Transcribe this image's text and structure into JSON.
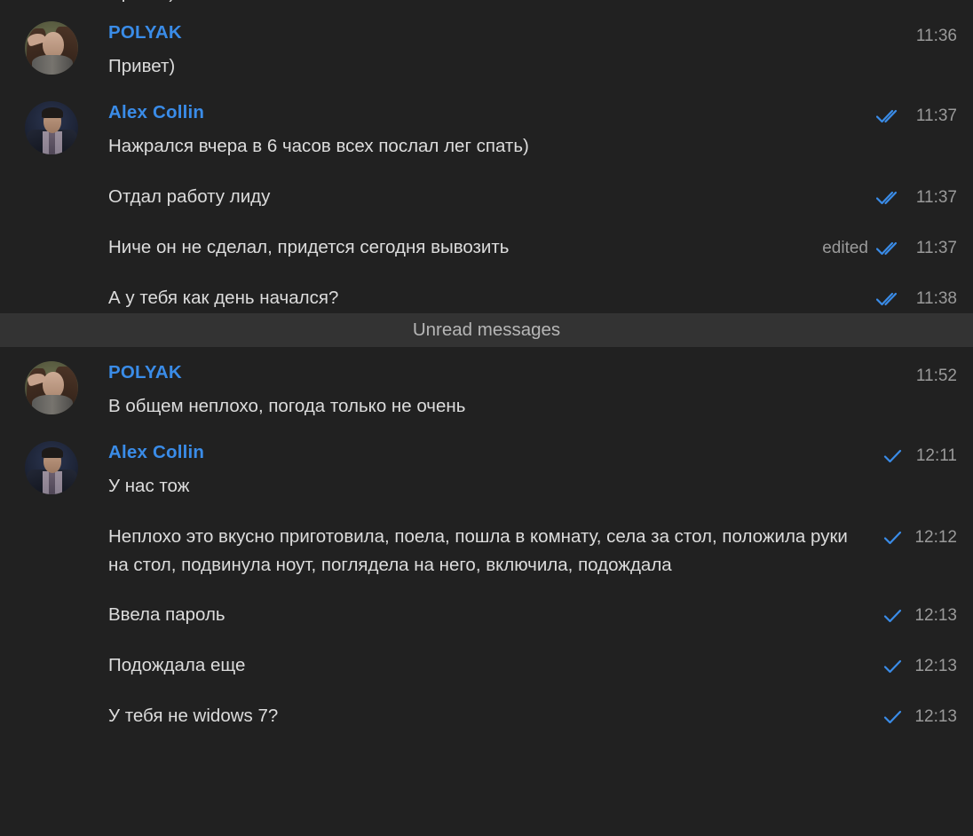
{
  "app": {
    "name": "telegram-chat",
    "background_color": "#212121",
    "accent_color": "#3a8ce8",
    "text_color": "#dcdcdc",
    "meta_color": "#9a9a9a",
    "divider_color": "#333333"
  },
  "cut_off_top": {
    "partial_text": "Привет)"
  },
  "divider": {
    "label": "Unread messages"
  },
  "groups": [
    {
      "sender": "POLYAK",
      "avatar": "av-polyak",
      "avatar_name": "avatar-polyak",
      "messages": [
        {
          "text": "Привет)",
          "time": "11:36",
          "ticks": "none",
          "edited": ""
        }
      ]
    },
    {
      "sender": "Alex Collin",
      "avatar": "av-alex",
      "avatar_name": "avatar-alex-collin",
      "messages": [
        {
          "text": "Нажрался вчера в 6 часов всех послал лег спать)",
          "time": "11:37",
          "ticks": "double",
          "edited": ""
        },
        {
          "text": "Отдал работу лиду",
          "time": "11:37",
          "ticks": "double",
          "edited": ""
        },
        {
          "text": "Ниче он не сделал, придется сегодня вывозить",
          "time": "11:37",
          "ticks": "double",
          "edited": "edited"
        },
        {
          "text": "А у тебя как день начался?",
          "time": "11:38",
          "ticks": "double",
          "edited": ""
        }
      ]
    },
    {
      "sender": "POLYAK",
      "avatar": "av-polyak",
      "avatar_name": "avatar-polyak",
      "messages": [
        {
          "text": "В общем неплохо, погода только не очень",
          "time": "11:52",
          "ticks": "none",
          "edited": ""
        }
      ]
    },
    {
      "sender": "Alex Collin",
      "avatar": "av-alex",
      "avatar_name": "avatar-alex-collin",
      "messages": [
        {
          "text": "У нас тож",
          "time": "12:11",
          "ticks": "single",
          "edited": ""
        },
        {
          "text": "Неплохо это вкусно приготовила, поела, пошла в комнату, села за стол, положила руки на стол, подвинула ноут, поглядела на него, включила, подождала",
          "time": "12:12",
          "ticks": "single",
          "edited": ""
        },
        {
          "text": "Ввела пароль",
          "time": "12:13",
          "ticks": "single",
          "edited": ""
        },
        {
          "text": "Подождала еще",
          "time": "12:13",
          "ticks": "single",
          "edited": ""
        },
        {
          "text": "У тебя не widows 7?",
          "time": "12:13",
          "ticks": "single",
          "edited": ""
        }
      ]
    }
  ]
}
